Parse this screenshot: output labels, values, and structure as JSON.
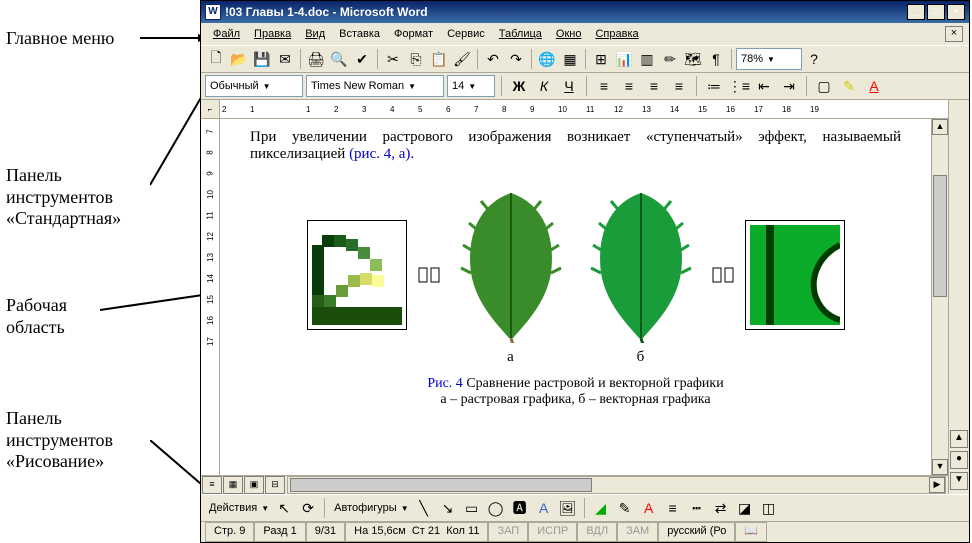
{
  "labels": {
    "mainmenu": "Главное меню",
    "standard": "Панель\nинструментов\n«Стандартная»",
    "workarea": "Рабочая\nобласть",
    "drawing": "Панель\nинструментов\n«Рисование»"
  },
  "title": "!03 Главы 1-4.doc - Microsoft Word",
  "menu": [
    "Файл",
    "Правка",
    "Вид",
    "Вставка",
    "Формат",
    "Сервис",
    "Таблица",
    "Окно",
    "Справка"
  ],
  "zoom": "78%",
  "format": {
    "style": "Обычный",
    "font": "Times New Roman",
    "size": "14"
  },
  "doc": {
    "paragraph": "При увеличении растрового изображения возникает «ступенчатый» эффект, называемый пикселизацией ",
    "ref": "(рис. 4, а)",
    "lbla": "а",
    "lblb": "б",
    "fignum": "Рис. 4",
    "figtitle": " Сравнение растровой и векторной графики",
    "figsub": "а – растровая графика, б – векторная графика"
  },
  "draw": {
    "actions": "Действия",
    "autoshapes": "Автофигуры"
  },
  "status": {
    "page": "Стр. 9",
    "sect": "Разд 1",
    "pages": "9/31",
    "pos": "На 15,6см",
    "col": "Ст 21",
    "kol": "Кол 11",
    "rec": "ЗАП",
    "trk": "ИСПР",
    "ext": "ВДЛ",
    "ovr": "ЗАМ",
    "lang": "русский (Ро"
  },
  "ruler_h": [
    "2",
    "1",
    "",
    "1",
    "2",
    "3",
    "4",
    "5",
    "6",
    "7",
    "8",
    "9",
    "10",
    "11",
    "12",
    "13",
    "14",
    "15",
    "16",
    "17",
    "18",
    "19"
  ],
  "ruler_v": [
    "7",
    "8",
    "9",
    "10",
    "11",
    "12",
    "13",
    "14",
    "15",
    "16",
    "17"
  ]
}
